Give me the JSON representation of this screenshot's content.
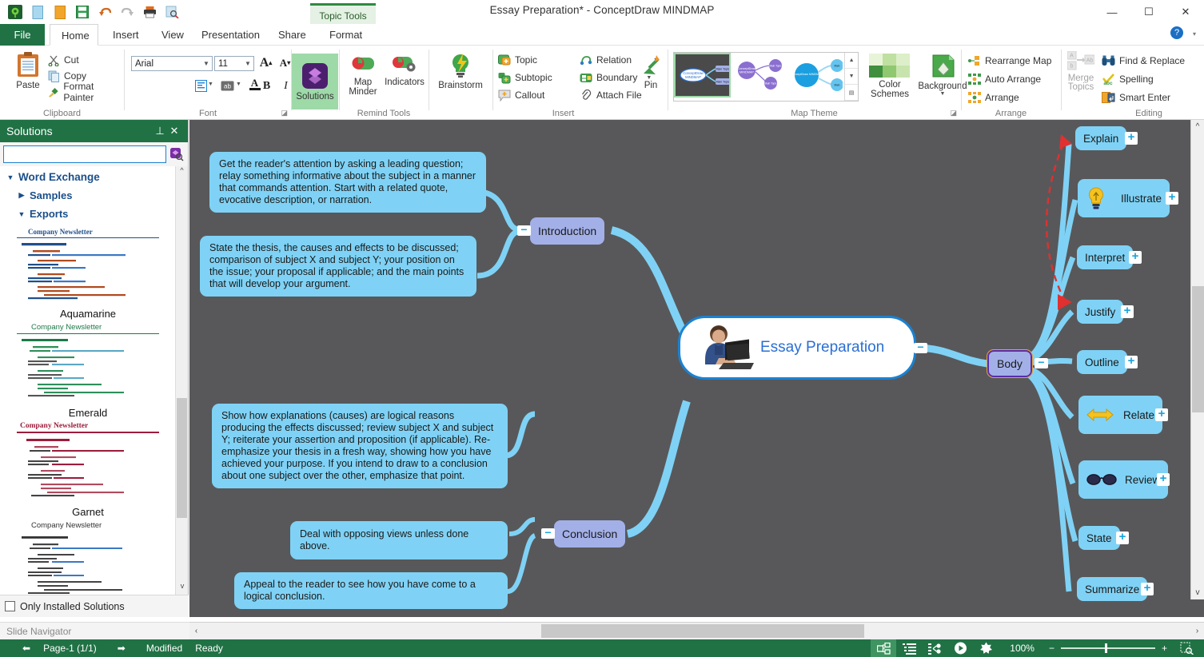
{
  "window": {
    "title": "Essay Preparation* - ConceptDraw MINDMAP",
    "minimize": "—",
    "maximize": "☐",
    "close": "✕",
    "help": "?",
    "help_caret": "▾"
  },
  "quick_access": [
    {
      "name": "app-logo-icon",
      "glyph": "◉"
    },
    {
      "name": "new-document-icon",
      "glyph": "▯"
    },
    {
      "name": "open-folder-icon",
      "glyph": "▮"
    },
    {
      "name": "save-icon",
      "glyph": "▤"
    },
    {
      "name": "undo-icon",
      "glyph": "↶"
    },
    {
      "name": "redo-icon",
      "glyph": "↷"
    },
    {
      "name": "print-icon",
      "glyph": "⎙"
    },
    {
      "name": "print-preview-icon",
      "glyph": "⌕"
    }
  ],
  "contextual_tab": "Topic Tools",
  "tabs": [
    {
      "label": "File",
      "active": false,
      "file": true
    },
    {
      "label": "Home",
      "active": true
    },
    {
      "label": "Insert",
      "active": false
    },
    {
      "label": "View",
      "active": false
    },
    {
      "label": "Presentation",
      "active": false
    },
    {
      "label": "Share",
      "active": false
    },
    {
      "label": "Format",
      "active": false
    }
  ],
  "ribbon": {
    "clipboard": {
      "label": "Clipboard",
      "paste": "Paste",
      "items": [
        "Cut",
        "Copy",
        "Format Painter"
      ]
    },
    "font": {
      "label": "Font",
      "family": "Arial",
      "size": "11",
      "grow": "A",
      "shrink": "A",
      "bold": "B",
      "italic": "I",
      "underline": "U",
      "align": "▤",
      "highlight": "ab",
      "color": "A"
    },
    "solutions": {
      "label": "Solutions"
    },
    "remind_tools": {
      "label": "Remind Tools",
      "items": [
        "Map Minder",
        "Indicators"
      ]
    },
    "brainstorm": {
      "label": "Brainstorm"
    },
    "insert": {
      "label": "Insert",
      "items": [
        "Topic",
        "Subtopic",
        "Callout",
        "Relation",
        "Boundary",
        "Attach File"
      ],
      "pin": "Pin"
    },
    "map_theme": {
      "label": "Map Theme",
      "color_schemes": "Color Schemes",
      "background": "Background",
      "spin_up": "▲",
      "spin_down": "▼",
      "spin_more": "▤"
    },
    "arrange": {
      "label": "Arrange",
      "items": [
        "Rearrange Map",
        "Auto Arrange",
        "Arrange"
      ]
    },
    "editing": {
      "label": "Editing",
      "merge_topics": "Merge Topics",
      "items": [
        "Find & Replace",
        "Spelling",
        "Smart Enter"
      ]
    }
  },
  "panel": {
    "title": "Solutions",
    "pin": "⊥",
    "close": "✕",
    "search_value": "",
    "search_placeholder": "",
    "search_button_icon": "solutions-search-icon",
    "tree": [
      {
        "label": "Word Exchange",
        "expanded": true,
        "caret": "▼",
        "indent": 0
      },
      {
        "label": "Samples",
        "expanded": false,
        "caret": "▶",
        "indent": 1
      },
      {
        "label": "Exports",
        "expanded": true,
        "caret": "▼",
        "indent": 1
      }
    ],
    "previews": [
      {
        "title": "Aquamarine",
        "doc_title": "Company Newsletter",
        "accent": "#1f4f8a"
      },
      {
        "title": "Emerald",
        "doc_title": "Company Newsletter",
        "accent": "#1d7a4a"
      },
      {
        "title": "Garnet",
        "doc_title": "Company Newsletter",
        "accent": "#9c1d3c"
      },
      {
        "title": "",
        "doc_title": "Company Newsletter",
        "accent": "#333333"
      }
    ],
    "footer_checkbox_label": "Only Installed Solutions",
    "footer_checked": false
  },
  "mindmap": {
    "central": {
      "label": "Essay Preparation",
      "icon": "person-at-laptop-icon",
      "collapse": "−"
    },
    "main_topics": [
      {
        "id": "introduction",
        "label": "Introduction",
        "collapse": "−",
        "selected": false
      },
      {
        "id": "body",
        "label": "Body",
        "collapse": "−",
        "selected": true
      },
      {
        "id": "conclusion",
        "label": "Conclusion",
        "collapse": "−",
        "selected": false
      }
    ],
    "intro_callouts": [
      "Get the reader's attention by asking a leading question; relay something informative about the subject in a manner that commands attention. Start with a related quote, evocative description, or narration.",
      "State the thesis, the causes and effects to be discussed; comparison of subject X and subject Y; your position on the issue; your proposal if applicable; and the main points that will develop your argument."
    ],
    "conclusion_callouts": [
      "Show how explanations (causes) are logical reasons producing the effects discussed; review subject X and subject Y; reiterate your assertion and proposition (if applicable). Re-emphasize your thesis in a fresh way, showing how you have achieved your purpose. If you intend to draw to a conclusion about one subject over the other, emphasize that point.",
      "Deal with opposing views unless done above.",
      "Appeal to the reader to see how you have come to a logical conclusion."
    ],
    "body_subtopics": [
      {
        "label": "Explain",
        "icon": null,
        "expand": "+",
        "marker": "red-arrow"
      },
      {
        "label": "Illustrate",
        "icon": "lightbulb-icon",
        "expand": "+",
        "marker": null
      },
      {
        "label": "Interpret",
        "icon": null,
        "expand": "+",
        "marker": null
      },
      {
        "label": "Justify",
        "icon": null,
        "expand": "+",
        "marker": "red-arrow"
      },
      {
        "label": "Outline",
        "icon": null,
        "expand": "+",
        "marker": null
      },
      {
        "label": "Relate",
        "icon": "double-arrow-icon",
        "expand": "+",
        "marker": null
      },
      {
        "label": "Review",
        "icon": "glasses-icon",
        "expand": "+",
        "marker": null
      },
      {
        "label": "State",
        "icon": null,
        "expand": "+",
        "marker": null
      },
      {
        "label": "Summarize",
        "icon": null,
        "expand": "+",
        "marker": null
      }
    ],
    "colors": {
      "canvas_bg": "#58585a",
      "callout_fill": "#7fd2f5",
      "main_topic_fill": "#a3b0e8",
      "central_border": "#1b82d2",
      "link_stroke": "#7fd2f5",
      "relation_stroke": "#e03030"
    }
  },
  "slide_navigator": {
    "label": "Slide Navigator"
  },
  "statusbar": {
    "prev": "⬅",
    "page": "Page-1 (1/1)",
    "next": "➡",
    "modified": "Modified",
    "ready": "Ready",
    "view_buttons": [
      {
        "name": "view-mindmap",
        "glyph": "▣",
        "active": true
      },
      {
        "name": "view-outline",
        "glyph": "☰",
        "active": false
      },
      {
        "name": "view-tree",
        "glyph": "⛬",
        "active": false
      },
      {
        "name": "view-presentation",
        "glyph": "▶",
        "active": false
      },
      {
        "name": "view-brainstorm",
        "glyph": "✿",
        "active": false
      }
    ],
    "zoom_level": "100%",
    "zoom_out": "−",
    "zoom_in": "+",
    "fit_page_icon": "fit-page-icon"
  },
  "scrollbars": {
    "h_left": "‹",
    "h_right": "›",
    "v_up": "^",
    "v_down": "v"
  }
}
